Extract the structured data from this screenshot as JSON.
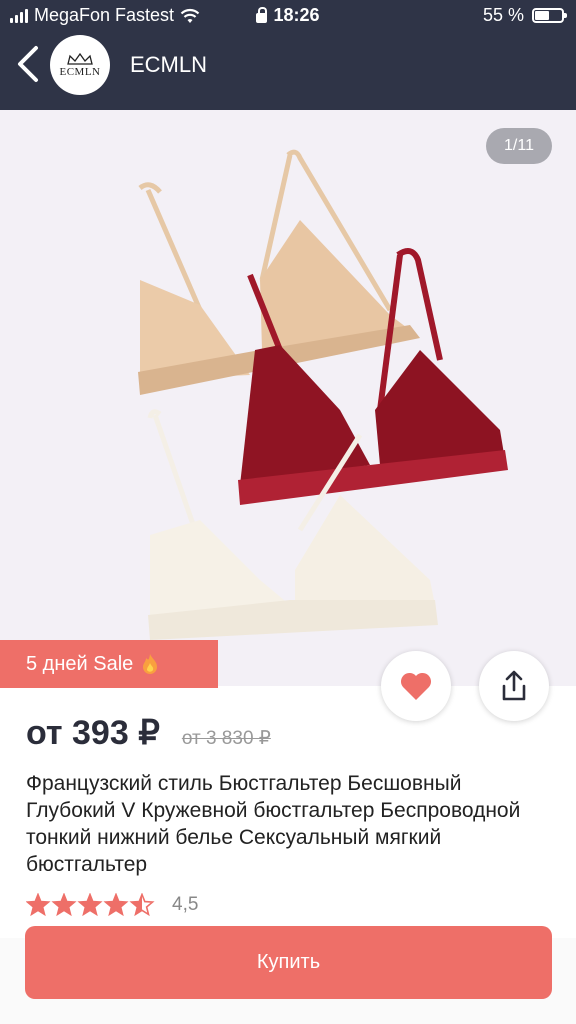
{
  "status_bar": {
    "carrier": "MegaFon Fastest",
    "time": "18:26",
    "battery": "55 %",
    "battery_level": 0.55
  },
  "header": {
    "shop_name": "ECMLN",
    "logo_text": "ECMLN"
  },
  "gallery": {
    "counter": "1/11"
  },
  "sale_badge": {
    "label": "5 дней Sale"
  },
  "price": {
    "current": "от 393 ₽",
    "old": "от 3 830 ₽"
  },
  "product": {
    "title": "Французский стиль Бюстгальтер Бесшовный Глубокий V Кружевной бюстгальтер Беспроводной тонкий нижний белье Сексуальный мягкий бюстгальтер"
  },
  "rating": {
    "value": "4,5",
    "stars": 4.5
  },
  "buy_button": {
    "label": "Купить"
  },
  "colors": {
    "header_bg": "#2f3447",
    "accent": "#ee6f68",
    "star": "#ee6f68",
    "photo_bg": "#f3f0f6"
  }
}
